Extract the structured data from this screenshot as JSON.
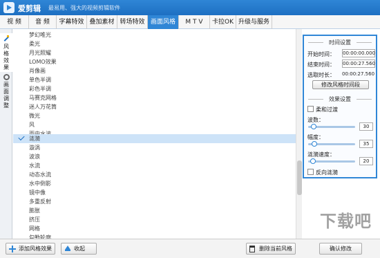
{
  "app": {
    "name": "爱剪辑",
    "slogan": "最易用、强大的视频剪辑软件"
  },
  "menu": [
    "视 频",
    "音 频",
    "字幕特效",
    "叠加素材",
    "转场特效",
    "画面风格",
    "M T V",
    "卡拉OK",
    "升级与服务"
  ],
  "menu_active": "画面风格",
  "left_tabs": {
    "style": "风格效果",
    "adjust": "画面调整"
  },
  "effects": [
    "梦幻唯光",
    "柔光",
    "月光照耀",
    "LOMO效果",
    "肖像画",
    "单色半调",
    "彩色半调",
    "马赛克网格",
    "迷人万花筒",
    "微光",
    "风",
    "雨中水波",
    "涟漪",
    "漩涡",
    "波浪",
    "水流",
    "动态水流",
    "水中倒影",
    "镜中像",
    "多重反射",
    "膨胀",
    "挤压",
    "网格",
    "勾勒轮廓",
    "旋转平移"
  ],
  "selected_effect": "涟漪",
  "panel": {
    "time_title": "时间设置",
    "start_label": "开始时间：",
    "start_value": "00:00:00.000",
    "end_label": "结束时间：",
    "end_value": "00:00:27.560",
    "duration_label": "选取时长：",
    "duration_value": "00:00:27.560",
    "modify_btn": "修改风格时间段",
    "effect_title": "效果设置",
    "soft_label": "柔和过渡",
    "soft_checked": false,
    "wave_label": "波数：",
    "wave_value": "30",
    "amp_label": "幅度：",
    "amp_value": "35",
    "speed_label": "涟漪速度：",
    "speed_value": "20",
    "reverse_label": "反向涟漪",
    "reverse_checked": false
  },
  "footer": {
    "add": "添加风格效果",
    "collapse": "收起",
    "delete": "删除当前风格",
    "confirm": "确认修改"
  },
  "watermark": "下载吧",
  "colors": {
    "accent": "#2f86d6",
    "selection": "#cde3f8"
  }
}
